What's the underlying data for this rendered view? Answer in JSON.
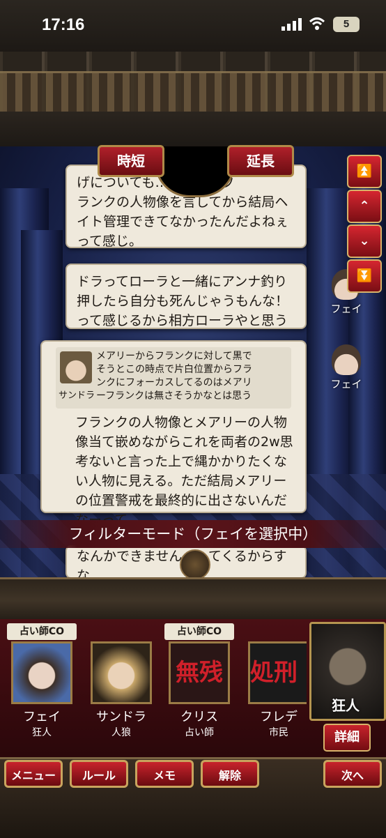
{
  "status": {
    "time": "17:16",
    "battery": "5"
  },
  "timer": {
    "shorten_label": "時短",
    "extend_label": "延長"
  },
  "scroll": {
    "top": "⏫",
    "up": "⌃",
    "down": "⌄",
    "bottom": "⏬"
  },
  "messages": [
    {
      "text": "げについても…いた後にフ\nランクの人物像を言してから結局ヘ\nイト管理できてなかったんだよねぇ\nって感じ。",
      "speaker": ""
    },
    {
      "text": "ドラってローラと一緒にアンナ釣り\n押したら自分も死んじゃうもんな！\nって感じるから相方ローラやと思う",
      "speaker": "フェイ"
    },
    {
      "quote": {
        "name": "サンドラ",
        "text": "メアリーからフランクに対して黒で\nそうとこの時点で片白位置からフラ\nンクにフォーカスしてるのはメアリ\nーフランクは無さそうかなとは思う"
      },
      "text": "フランクの人物像とメアリーの人物\n像当て嵌めながらこれを両者の2w思\n考ないと言った上で縄かかりたくな\nい人物に見える。ただ結局メアリー\nの位置警戒を最終的に出さないんだ\nなーって。",
      "speaker": "フェイ"
    },
    {
      "text": "なんかできません…してくるからすな\nない。",
      "speaker": ""
    }
  ],
  "filter": {
    "label": "フィルターモード（フェイを選択中）"
  },
  "players": [
    {
      "tag": "占い師CO",
      "name": "フェイ",
      "role": "狂人",
      "portrait_color": "#4a6aa8"
    },
    {
      "tag": "",
      "name": "サンドラ",
      "role": "人狼",
      "portrait_color": "#6b5a3a"
    },
    {
      "tag": "占い師CO",
      "name": "クリス",
      "role": "占い師",
      "portrait_color": "#2a1a1a",
      "stamp": "無残"
    },
    {
      "tag": "",
      "name": "フレデ",
      "role": "市民",
      "portrait_color": "#1a1a1a",
      "stamp": "処刑"
    }
  ],
  "self": {
    "role": "狂人",
    "detail_label": "詳細"
  },
  "menu": {
    "menu": "メニュー",
    "rule": "ルール",
    "memo": "メモ",
    "release": "解除",
    "next": "次へ"
  }
}
